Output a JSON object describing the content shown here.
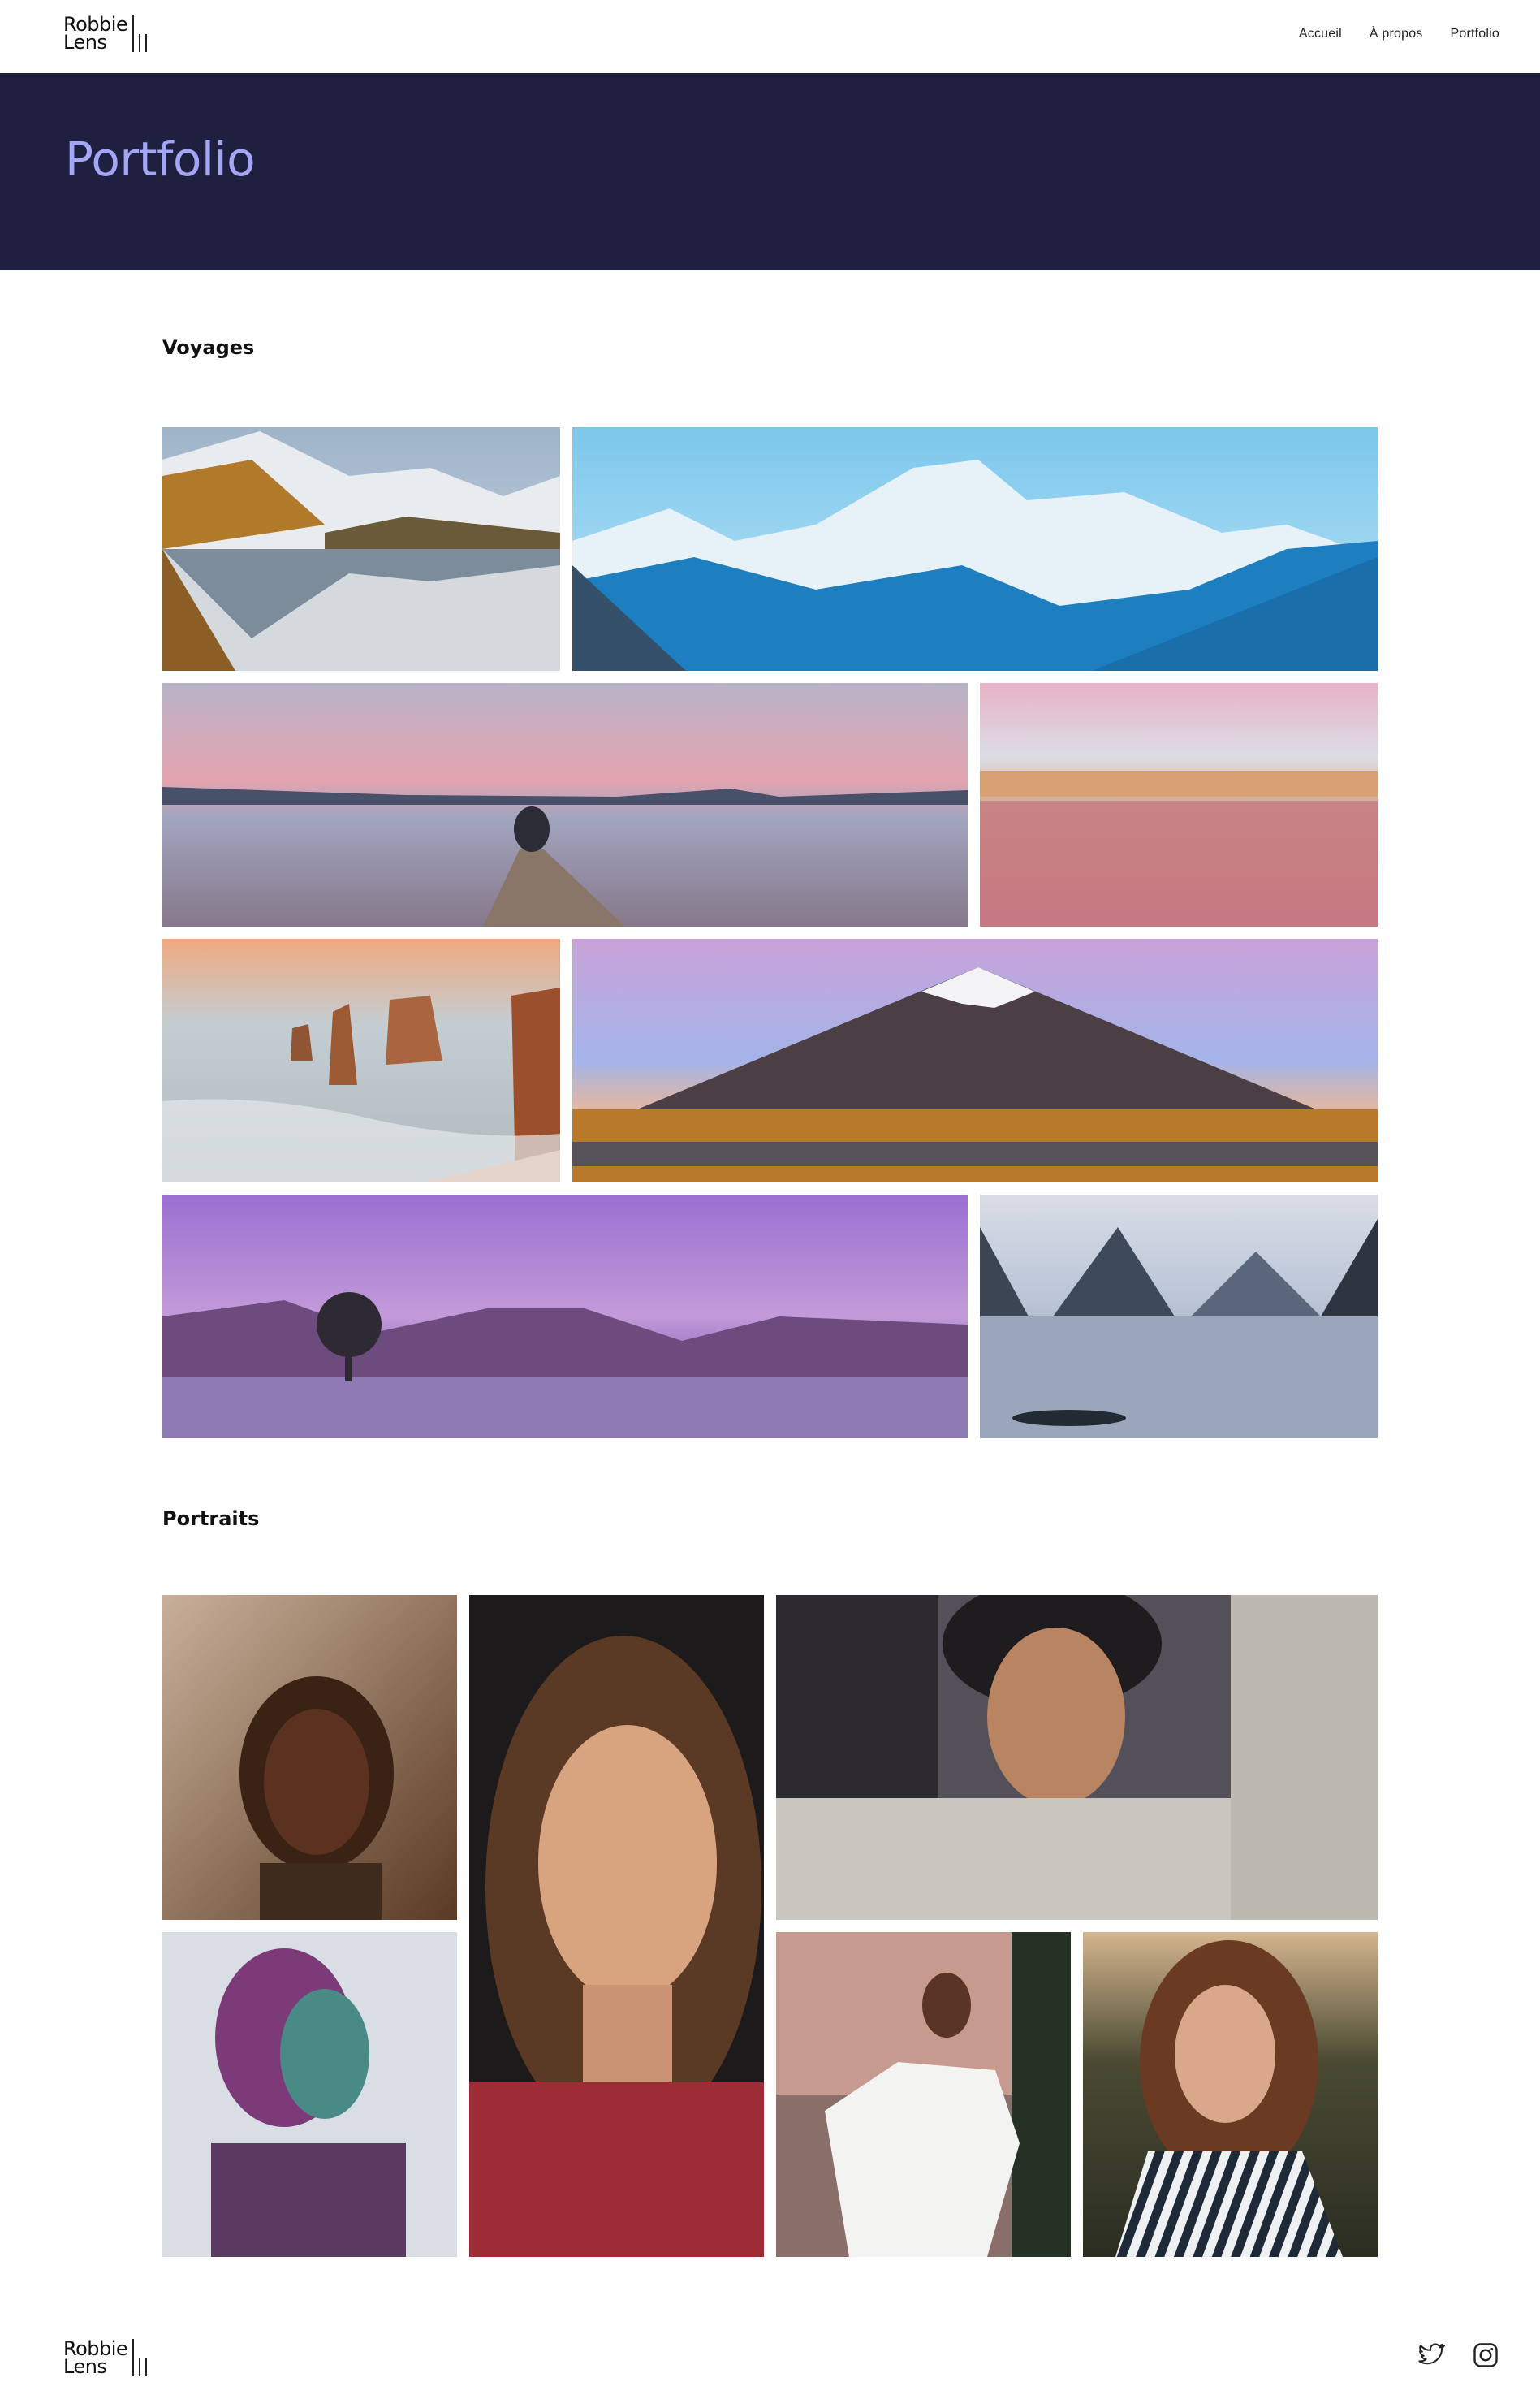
{
  "brand": {
    "name_line1": "Robbie",
    "name_line2": "Lens"
  },
  "nav": {
    "home": "Accueil",
    "about": "À propos",
    "portfolio": "Portfolio"
  },
  "hero": {
    "title": "Portfolio"
  },
  "sections": {
    "travel": "Voyages",
    "portraits": "Portraits"
  },
  "travel_photos": [
    "snowy-mountains-lake-reflection",
    "blue-mountain-range",
    "couple-on-pier-at-dusk",
    "pink-beach-reflection",
    "coastal-rock-stacks",
    "snowcapped-volcano",
    "lone-tree-in-lake-purple-sky",
    "fjord-peaks-reflection"
  ],
  "portrait_photos": [
    "woman-hands-on-head",
    "woman-close-up-red-top",
    "man-hat-hoodie",
    "woman-purple-light-profile",
    "woman-white-tshirt",
    "woman-striped-shirt"
  ],
  "footer": {
    "social": [
      "twitter-icon",
      "instagram-icon"
    ]
  }
}
